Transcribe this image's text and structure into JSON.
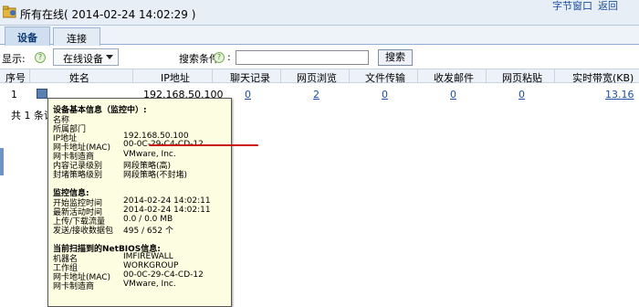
{
  "window": {
    "title": "所有在线( 2014-02-24 14:02:29 )",
    "top_right_1": "字节窗口",
    "top_right_2": "返回"
  },
  "tabs": [
    {
      "label": "设备",
      "active": true
    },
    {
      "label": "连接",
      "active": false
    }
  ],
  "toolbar": {
    "display_label": "显示:",
    "display_select": "在线设备",
    "search_label": "搜索条件",
    "search_colon": ":",
    "search_value": "",
    "search_button": "搜索"
  },
  "table": {
    "columns": [
      "序号",
      "姓名",
      "IP地址",
      "聊天记录",
      "网页浏览",
      "文件传输",
      "收发邮件",
      "网页粘贴",
      "实时带宽(KB)"
    ],
    "rows": [
      {
        "index": "1",
        "name": "",
        "ip": "192.168.50.100",
        "chat": "0",
        "web": "2",
        "file": "0",
        "mail": "0",
        "paste": "0",
        "bandwidth": "13.16"
      }
    ],
    "total_text": "共 1 条记录"
  },
  "tooltip": {
    "basic_title": "设备基本信息（监控中）:",
    "basic": [
      {
        "label": "名称",
        "value": ""
      },
      {
        "label": "所属部门",
        "value": ""
      },
      {
        "label": "IP地址",
        "value": "192.168.50.100"
      },
      {
        "label": "网卡地址(MAC)",
        "value": "00-0C-29-C4-CD-12"
      },
      {
        "label": "网卡制造商",
        "value": "VMware, Inc."
      },
      {
        "label": "内容记录级别",
        "value": "网段策略(高)"
      },
      {
        "label": "封堵策略级别",
        "value": "网段策略(不封堵)"
      }
    ],
    "monitor_title": "监控信息:",
    "monitor": [
      {
        "label": "开始监控时间",
        "value": "2014-02-24 14:02:11"
      },
      {
        "label": "最新活动时间",
        "value": "2014-02-24 14:02:11"
      },
      {
        "label": "上传/下载流量",
        "value": "0.0 / 0.0 MB"
      },
      {
        "label": "发送/接收数据包",
        "value": "495 / 652 个"
      }
    ],
    "netbios_title": "当前扫描到的NetBIOS信息:",
    "netbios": [
      {
        "label": "机器名",
        "value": "IMFIREWALL"
      },
      {
        "label": "工作组",
        "value": "WORKGROUP"
      },
      {
        "label": "网卡地址(MAC)",
        "value": "00-0C-29-C4-CD-12"
      },
      {
        "label": "网卡制造商",
        "value": "VMware, Inc."
      }
    ]
  },
  "colors": {
    "accent": "#1d4fa6",
    "highlight_underline": "#cc1111",
    "tooltip_bg": "#fdfde2"
  }
}
